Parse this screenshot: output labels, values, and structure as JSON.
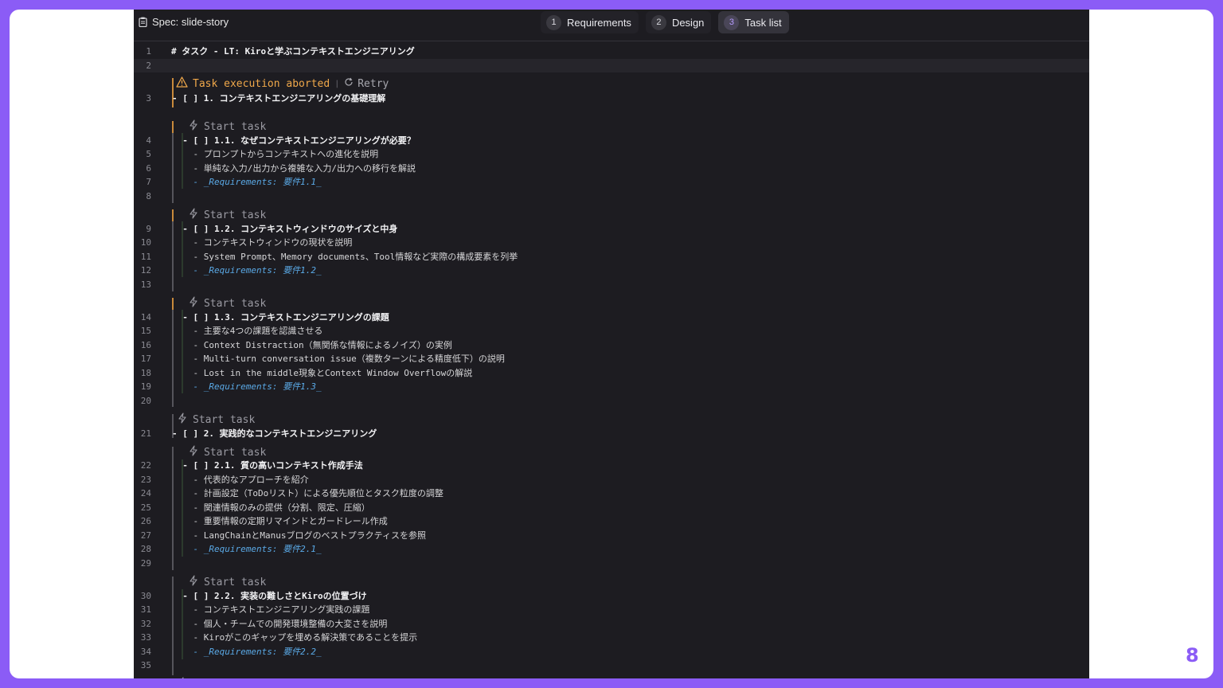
{
  "header": {
    "spec_title": "Spec: slide-story",
    "tabs": [
      {
        "num": "1",
        "label": "Requirements"
      },
      {
        "num": "2",
        "label": "Design"
      },
      {
        "num": "3",
        "label": "Task list"
      }
    ]
  },
  "codelens": {
    "aborted": "Task execution aborted",
    "separator": "|",
    "retry": "Retry",
    "start_task": "Start task"
  },
  "lines": [
    {
      "n": "1",
      "text": "# タスク - LT: Kiroと学ぶコンテキストエンジニアリング"
    },
    {
      "n": "2",
      "text": ""
    },
    {
      "n": "3",
      "text": "- [ ] 1. コンテキストエンジニアリングの基礎理解"
    },
    {
      "n": "4",
      "text": "  - [ ] 1.1. なぜコンテキストエンジニアリングが必要？"
    },
    {
      "n": "5",
      "text": "    - プロンプトからコンテキストへの進化を説明"
    },
    {
      "n": "6",
      "text": "    - 単純な入力/出力から複雑な入力/出力への移行を解説"
    },
    {
      "n": "7",
      "text": "    - _Requirements: 要件1.1_"
    },
    {
      "n": "8",
      "text": ""
    },
    {
      "n": "9",
      "text": "  - [ ] 1.2. コンテキストウィンドウのサイズと中身"
    },
    {
      "n": "10",
      "text": "    - コンテキストウィンドウの現状を説明"
    },
    {
      "n": "11",
      "text": "    - System Prompt、Memory documents、Tool情報など実際の構成要素を列挙"
    },
    {
      "n": "12",
      "text": "    - _Requirements: 要件1.2_"
    },
    {
      "n": "13",
      "text": ""
    },
    {
      "n": "14",
      "text": "  - [ ] 1.3. コンテキストエンジニアリングの課題"
    },
    {
      "n": "15",
      "text": "    - 主要な4つの課題を認識させる"
    },
    {
      "n": "16",
      "text": "    - Context Distraction（無関係な情報によるノイズ）の実例"
    },
    {
      "n": "17",
      "text": "    - Multi-turn conversation issue（複数ターンによる精度低下）の説明"
    },
    {
      "n": "18",
      "text": "    - Lost in the middle現象とContext Window Overflowの解説"
    },
    {
      "n": "19",
      "text": "    - _Requirements: 要件1.3_"
    },
    {
      "n": "20",
      "text": ""
    },
    {
      "n": "21",
      "text": "- [ ] 2. 実践的なコンテキストエンジニアリング"
    },
    {
      "n": "22",
      "text": "  - [ ] 2.1. 質の高いコンテキスト作成手法"
    },
    {
      "n": "23",
      "text": "    - 代表的なアプローチを紹介"
    },
    {
      "n": "24",
      "text": "    - 計画設定（ToDoリスト）による優先順位とタスク粒度の調整"
    },
    {
      "n": "25",
      "text": "    - 関連情報のみの提供（分割、限定、圧縮）"
    },
    {
      "n": "26",
      "text": "    - 重要情報の定期リマインドとガードレール作成"
    },
    {
      "n": "27",
      "text": "    - LangChainとManusブログのベストプラクティスを参照"
    },
    {
      "n": "28",
      "text": "    - _Requirements: 要件2.1_"
    },
    {
      "n": "29",
      "text": ""
    },
    {
      "n": "30",
      "text": "  - [ ] 2.2. 実装の難しさとKiroの位置づけ"
    },
    {
      "n": "31",
      "text": "    - コンテキストエンジニアリング実践の課題"
    },
    {
      "n": "32",
      "text": "    - 個人・チームでの開発環境整備の大変さを説明"
    },
    {
      "n": "33",
      "text": "    - Kiroがこのギャップを埋める解決策であることを提示"
    },
    {
      "n": "34",
      "text": "    - _Requirements: 要件2.2_"
    },
    {
      "n": "35",
      "text": ""
    }
  ],
  "slide_number": "8",
  "colors": {
    "accent": "#8b5cf6",
    "editor_bg": "#1d1c21",
    "requirement_link": "#5aa9e6",
    "abort": "#f0a84a"
  }
}
